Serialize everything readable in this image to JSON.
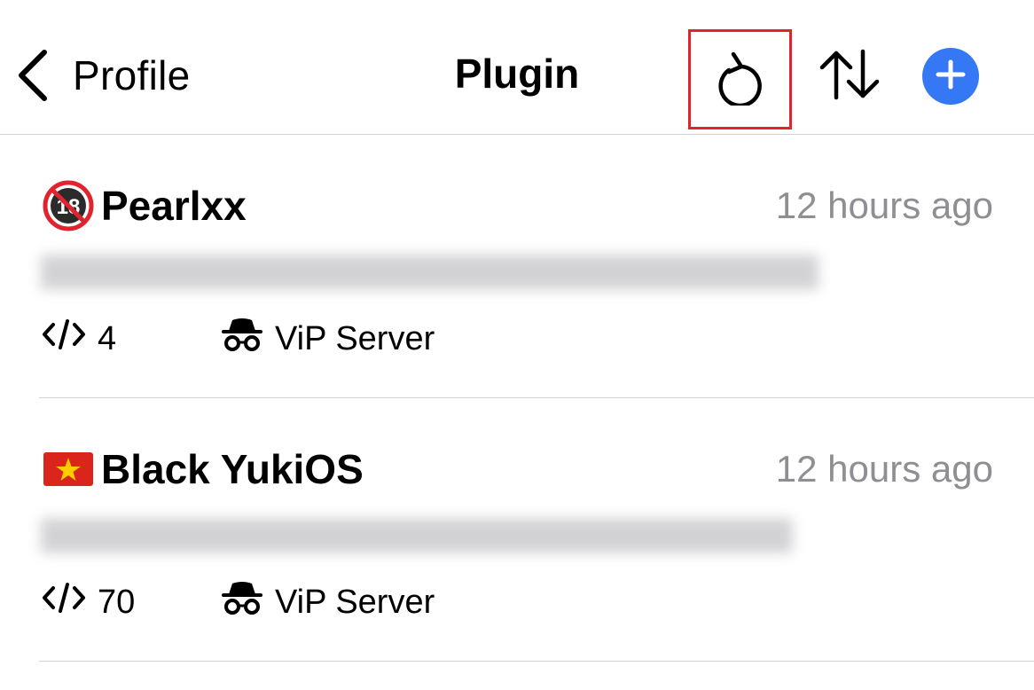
{
  "navbar": {
    "back_label": "Profile",
    "title": "Plugin",
    "icons": {
      "back": "chevron-left-icon",
      "refresh": "refresh-icon",
      "sort": "sort-arrows-icon",
      "add": "plus-circle-icon"
    },
    "colors": {
      "add_button": "#3478f6",
      "highlight_box": "#e0242f"
    }
  },
  "plugins": [
    {
      "flag": "no-under-18-emoji",
      "name": "Pearlxx",
      "time": "12 hours ago",
      "count": "4",
      "server": "ViP Server"
    },
    {
      "flag": "vietnam-flag-emoji",
      "name": "Black YukiOS",
      "time": "12 hours ago",
      "count": "70",
      "server": "ViP Server"
    }
  ],
  "colors": {
    "secondary_text": "#8e8e93",
    "separator": "#d1d1d6"
  }
}
